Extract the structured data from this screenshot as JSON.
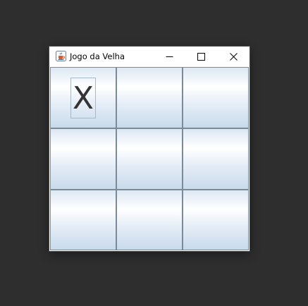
{
  "window": {
    "title": "Jogo da Velha",
    "icon": "java-cup-icon"
  },
  "titlebar_controls": {
    "minimize": "minimize-icon",
    "maximize": "maximize-icon",
    "close": "close-icon"
  },
  "board": {
    "cells": [
      "X",
      "",
      "",
      "",
      "",
      "",
      "",
      "",
      ""
    ]
  },
  "colors": {
    "desktop": "#2e2e2e",
    "cell_border": "#7a8a99",
    "mark": "#333333"
  }
}
